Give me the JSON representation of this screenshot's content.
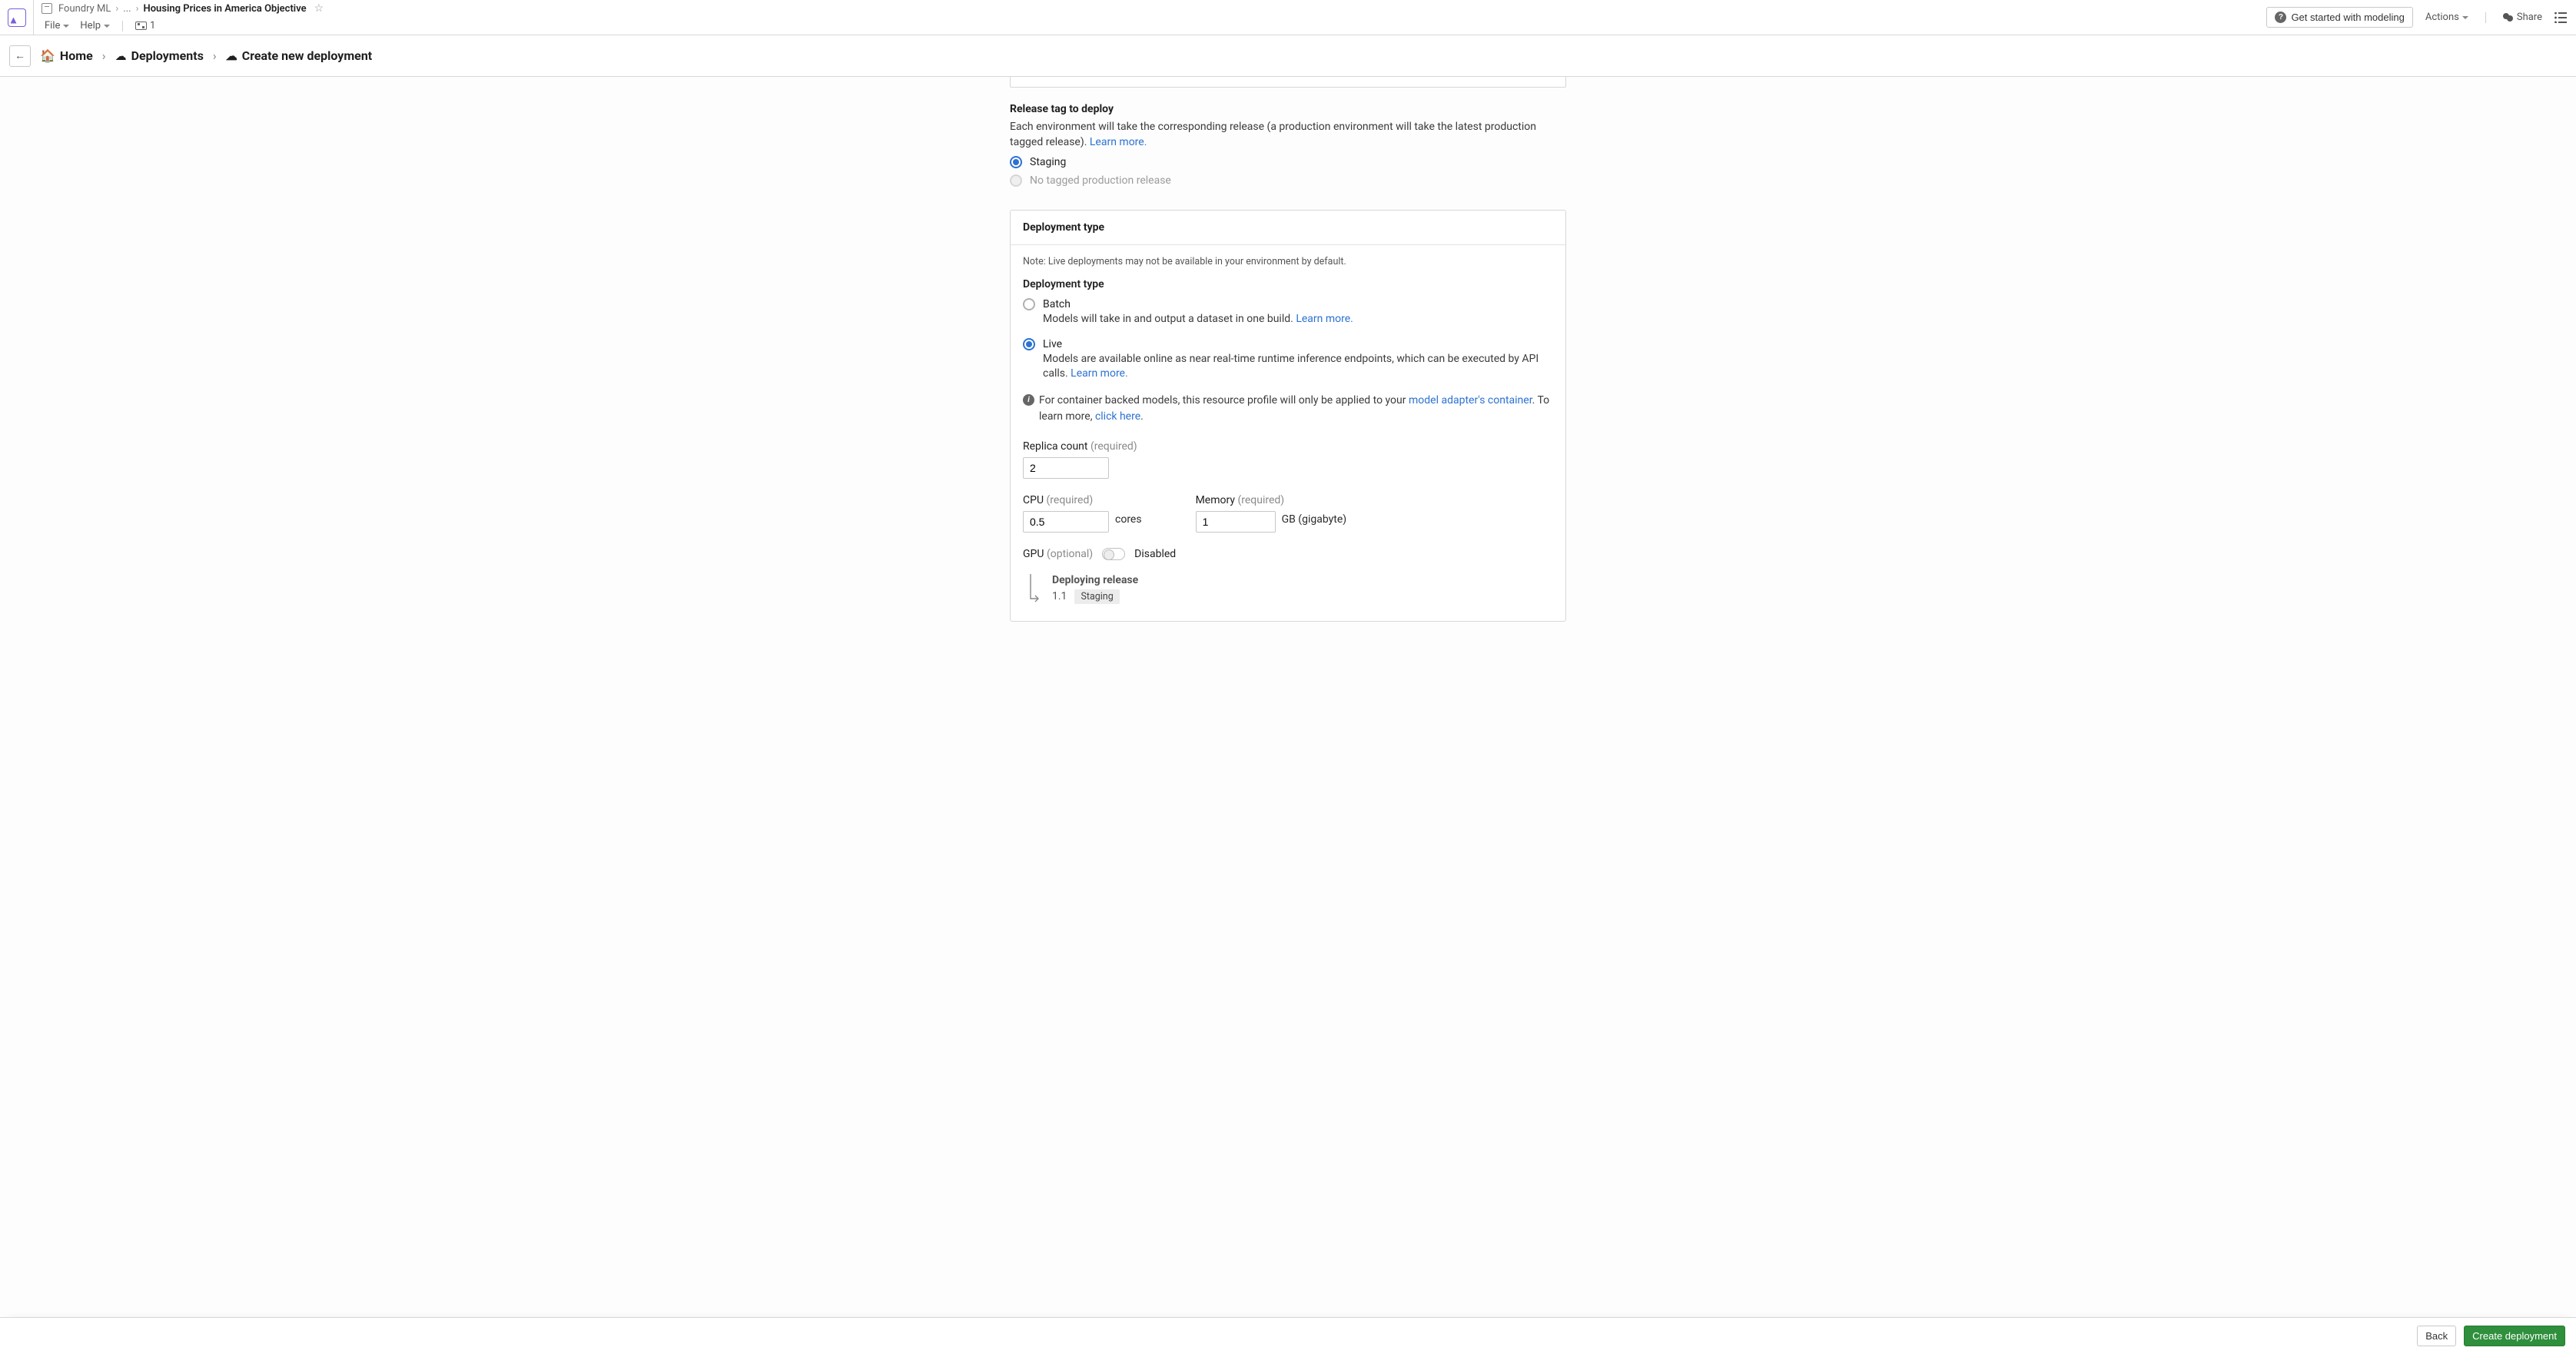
{
  "topPath": {
    "app": "Foundry ML",
    "ellipsis": "...",
    "title": "Housing Prices in America Objective"
  },
  "menus": {
    "file": "File",
    "help": "Help",
    "flowCount": "1"
  },
  "topButtons": {
    "getStarted": "Get started with modeling",
    "actions": "Actions",
    "share": "Share"
  },
  "breadcrumb": {
    "home": "Home",
    "deployments": "Deployments",
    "createNew": "Create new deployment"
  },
  "release": {
    "label": "Release tag to deploy",
    "help": "Each environment will take the corresponding release (a production environment will take the latest production tagged release).",
    "learnMore": "Learn more.",
    "optStaging": "Staging",
    "optProd": "No tagged production release"
  },
  "deployType": {
    "cardTitle": "Deployment type",
    "note": "Note: Live deployments may not be available in your environment by default.",
    "label": "Deployment type",
    "batch": {
      "title": "Batch",
      "desc": "Models will take in and output a dataset in one build.",
      "learnMore": "Learn more."
    },
    "live": {
      "title": "Live",
      "desc": "Models are available online as near real-time runtime inference endpoints, which can be executed by API calls.",
      "learnMore": "Learn more."
    },
    "infoPre": "For container backed models, this resource profile will only be applied to your",
    "infoLink1": "model adapter's container",
    "infoMid": ". To learn more,",
    "infoLink2": "click here",
    "infoEnd": "."
  },
  "resources": {
    "replica": {
      "label": "Replica count",
      "req": "(required)",
      "value": "2"
    },
    "cpu": {
      "label": "CPU",
      "req": "(required)",
      "value": "0.5",
      "unit": "cores"
    },
    "memory": {
      "label": "Memory",
      "req": "(required)",
      "value": "1",
      "unit": "GB (gigabyte)"
    },
    "gpu": {
      "label": "GPU",
      "opt": "(optional)",
      "state": "Disabled"
    }
  },
  "deploying": {
    "title": "Deploying release",
    "version": "1.1",
    "tag": "Staging"
  },
  "footer": {
    "back": "Back",
    "create": "Create deployment"
  }
}
